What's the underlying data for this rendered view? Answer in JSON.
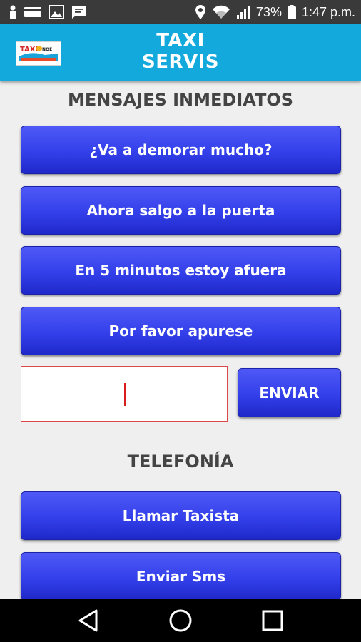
{
  "status_bar": {
    "battery": "73%",
    "time": "1:47 p.m."
  },
  "app_bar": {
    "title_line1": "TAXI",
    "title_line2": "SERVIS",
    "logo_text": "TAXI",
    "logo_suffix": "NOÉ"
  },
  "mensajes": {
    "title": "MENSAJES INMEDIATOS",
    "buttons": [
      "¿Va a demorar mucho?",
      "Ahora salgo a la puerta",
      "En 5 minutos estoy afuera",
      "Por favor apurese"
    ],
    "input_value": "",
    "send_label": "ENVIAR"
  },
  "telefonia": {
    "title": "TELEFONÍA",
    "buttons": [
      "Llamar Taxista",
      "Enviar Sms"
    ]
  },
  "colors": {
    "app_bar": "#13a9dc",
    "button": "#3340ea",
    "status_bar": "#3a3a3a",
    "background": "#efefef"
  }
}
